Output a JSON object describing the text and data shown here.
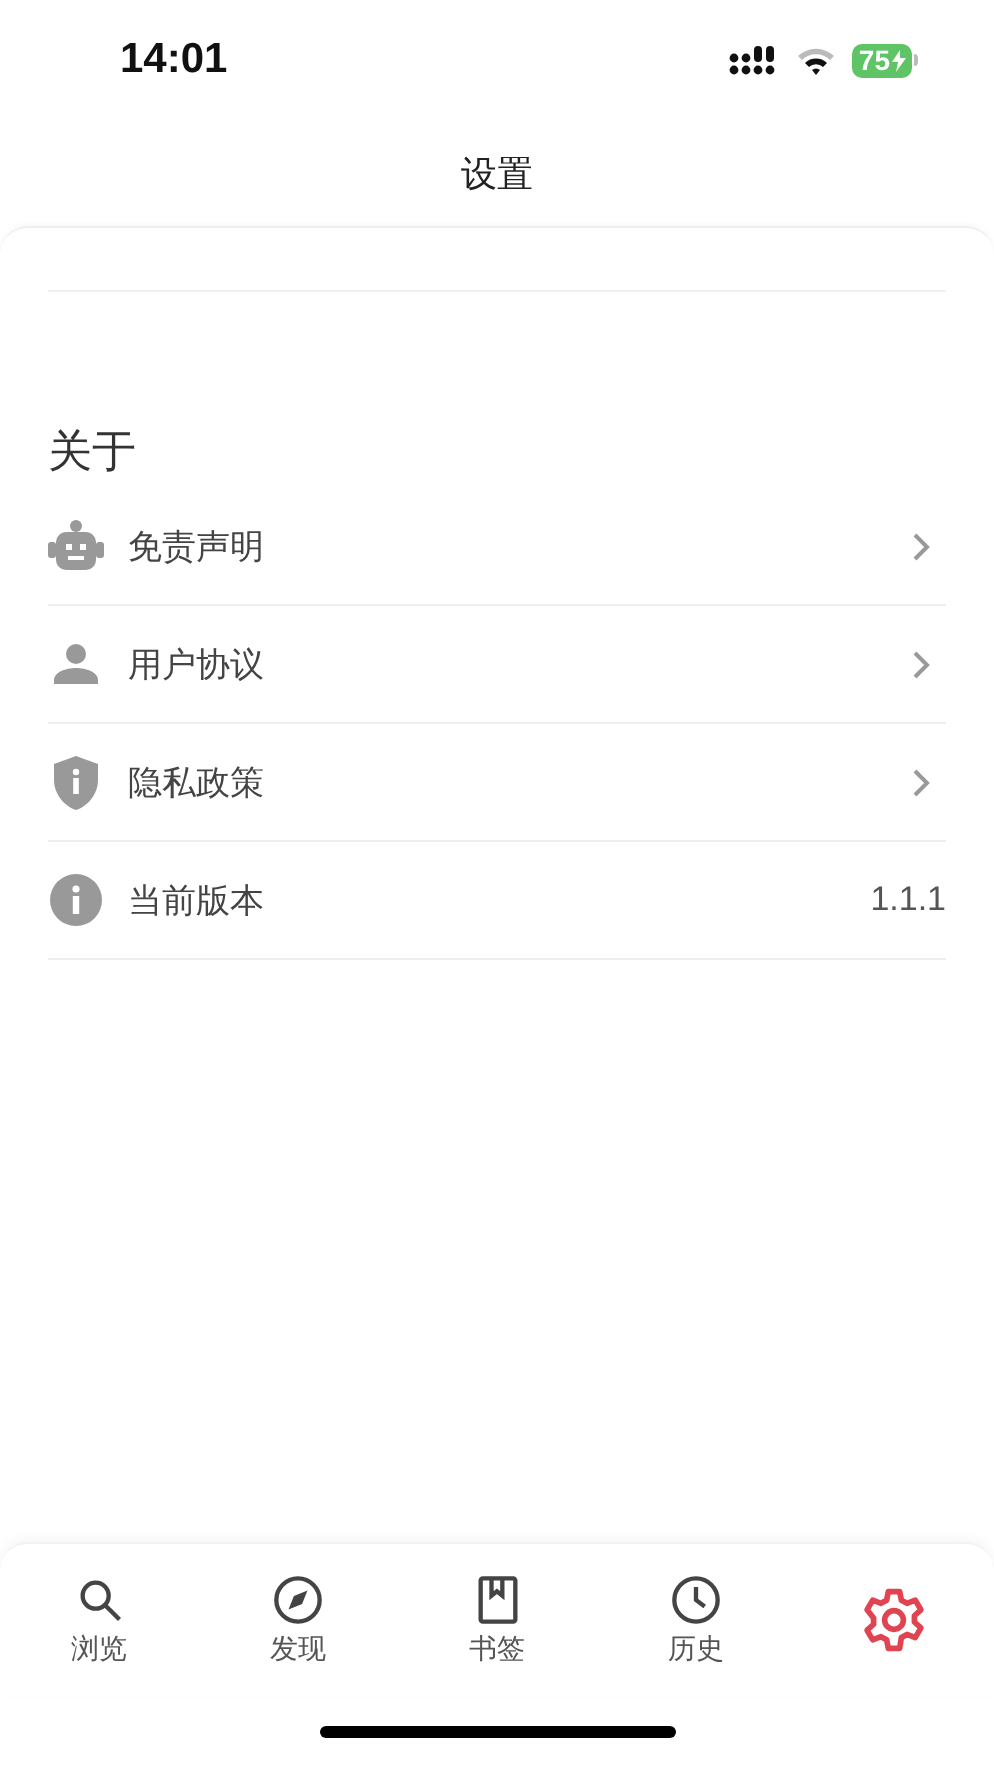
{
  "status_bar": {
    "time": "14:01",
    "battery": "75"
  },
  "nav": {
    "title": "设置"
  },
  "section": {
    "title": "关于",
    "items": [
      {
        "label": "免责声明",
        "kind": "link"
      },
      {
        "label": "用户协议",
        "kind": "link"
      },
      {
        "label": "隐私政策",
        "kind": "link"
      },
      {
        "label": "当前版本",
        "kind": "value",
        "value": "1.1.1"
      }
    ]
  },
  "tabs": [
    {
      "label": "浏览",
      "selected": false
    },
    {
      "label": "发现",
      "selected": false
    },
    {
      "label": "书签",
      "selected": false
    },
    {
      "label": "历史",
      "selected": false
    },
    {
      "selected": true
    }
  ]
}
